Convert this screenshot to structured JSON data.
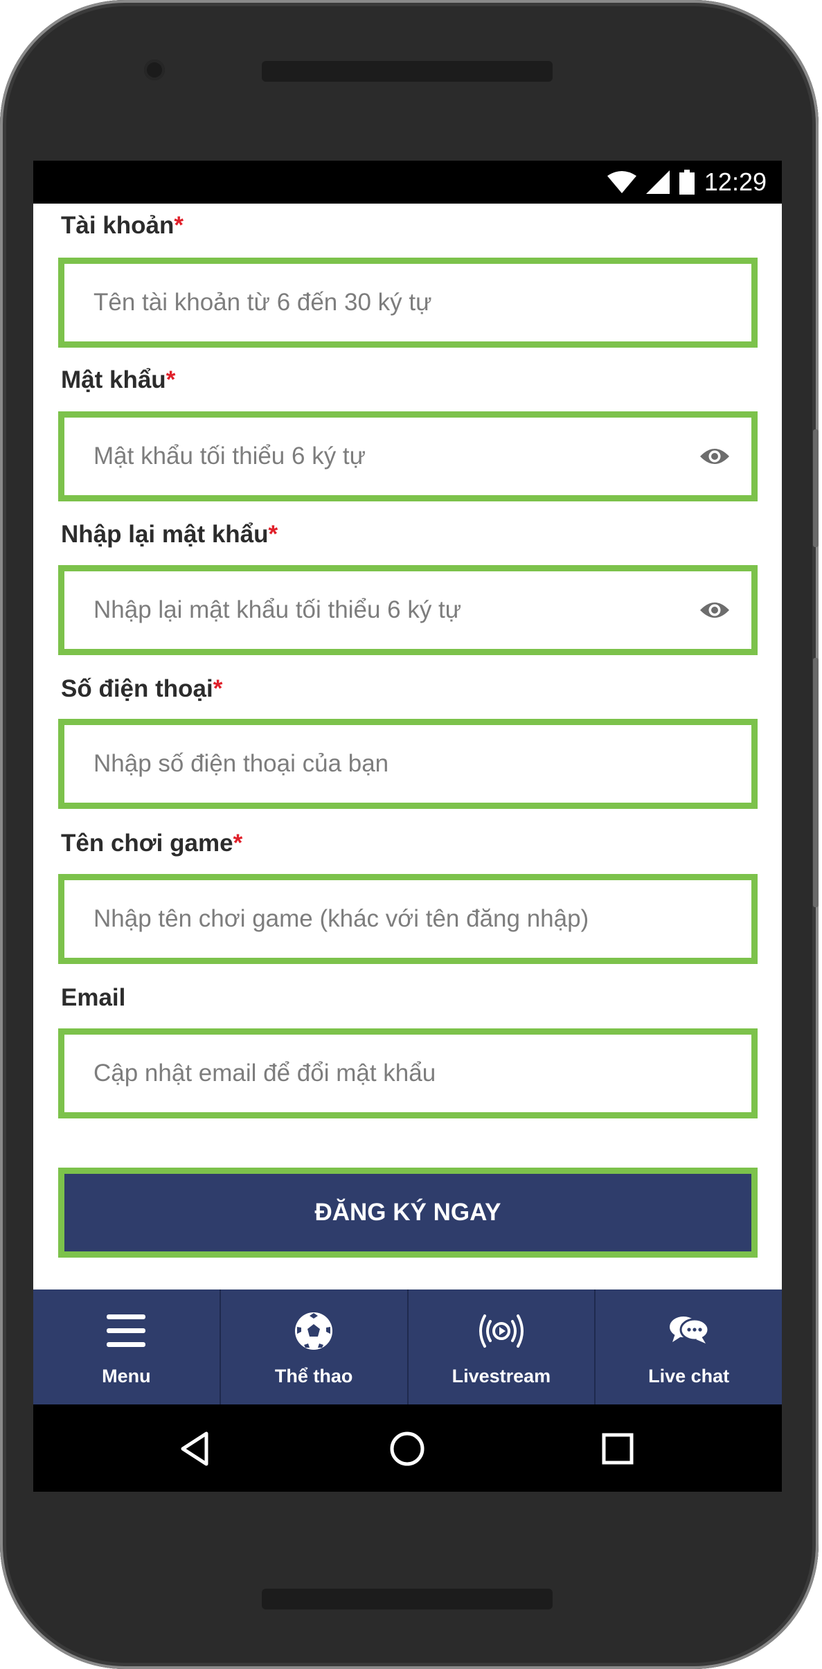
{
  "status_bar": {
    "time": "12:29",
    "icons": [
      "wifi-icon",
      "signal-icon",
      "battery-icon"
    ]
  },
  "form": {
    "fields": [
      {
        "label": "Tài khoản",
        "required": true,
        "placeholder": "Tên tài khoản từ 6 đến 30 ký tự",
        "value": "",
        "type": "text"
      },
      {
        "label": "Mật khẩu",
        "required": true,
        "placeholder": "Mật khẩu tối thiểu 6 ký tự",
        "value": "",
        "type": "password",
        "icon": "eye-icon"
      },
      {
        "label": "Nhập lại mật khẩu",
        "required": true,
        "placeholder": "Nhập lại mật khẩu tối thiểu 6 ký tự",
        "value": "",
        "type": "password",
        "icon": "eye-icon"
      },
      {
        "label": "Số điện thoại",
        "required": true,
        "placeholder": "Nhập số điện thoại của bạn",
        "value": "",
        "type": "tel"
      },
      {
        "label": "Tên chơi game",
        "required": true,
        "placeholder": "Nhập tên chơi game (khác với tên đăng nhập)",
        "value": "",
        "type": "text"
      },
      {
        "label": "Email",
        "required": false,
        "placeholder": "Cập nhật email để đổi mật khẩu",
        "value": "",
        "type": "email"
      }
    ],
    "required_mark": "*",
    "submit_label": "ĐĂNG KÝ NGAY"
  },
  "bottom_nav": {
    "items": [
      {
        "label": "Menu",
        "icon": "hamburger-icon"
      },
      {
        "label": "Thể thao",
        "icon": "soccer-ball-icon"
      },
      {
        "label": "Livestream",
        "icon": "broadcast-icon"
      },
      {
        "label": "Live chat",
        "icon": "chat-bubbles-icon"
      }
    ]
  },
  "android_nav": {
    "buttons": [
      "back-icon",
      "home-icon",
      "recents-icon"
    ]
  },
  "colors": {
    "field_border": "#7cc24b",
    "primary": "#2f3d6b",
    "required": "#e0202a",
    "placeholder": "#7d7d7d",
    "label": "#2c2c2c"
  }
}
